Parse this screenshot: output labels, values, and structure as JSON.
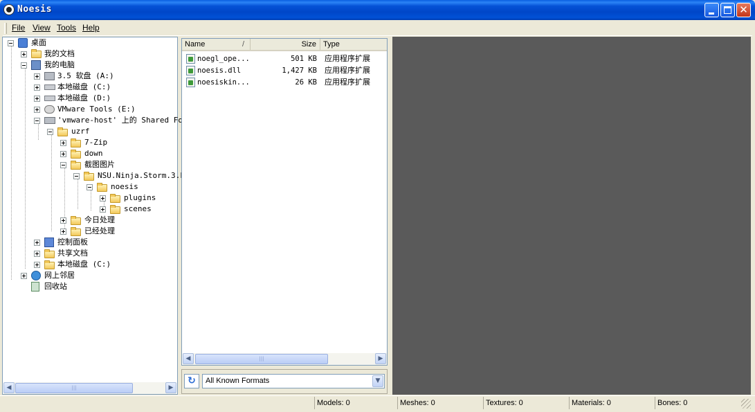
{
  "window": {
    "title": "Noesis"
  },
  "menu": [
    "File",
    "View",
    "Tools",
    "Help"
  ],
  "tree": [
    {
      "label": "桌面"
    },
    {
      "label": "我的文档"
    },
    {
      "label": "我的电脑"
    },
    {
      "label": "3.5 软盘 (A:)"
    },
    {
      "label": "本地磁盘 (C:)"
    },
    {
      "label": "本地磁盘 (D:)"
    },
    {
      "label": "VMware Tools (E:)"
    },
    {
      "label": "'vmware-host' 上的 Shared Fol"
    },
    {
      "label": "uzrf"
    },
    {
      "label": "7-Zip"
    },
    {
      "label": "down"
    },
    {
      "label": "截图图片"
    },
    {
      "label": "NSU.Ninja.Storm.3.F"
    },
    {
      "label": "noesis"
    },
    {
      "label": "plugins"
    },
    {
      "label": "scenes"
    },
    {
      "label": "今日处理"
    },
    {
      "label": "已经处理"
    },
    {
      "label": "控制面板"
    },
    {
      "label": "共享文档"
    },
    {
      "label": "本地磁盘 (C:)"
    },
    {
      "label": "网上邻居"
    },
    {
      "label": "回收站"
    }
  ],
  "file_list": {
    "columns": {
      "name": "Name",
      "sort_indicator": "/",
      "size": "Size",
      "type": "Type"
    },
    "rows": [
      {
        "name": "noegl_ope...",
        "size": "501 KB",
        "type": "应用程序扩展"
      },
      {
        "name": "noesis.dll",
        "size": "1,427 KB",
        "type": "应用程序扩展"
      },
      {
        "name": "noesiskin...",
        "size": "26 KB",
        "type": "应用程序扩展"
      }
    ]
  },
  "format_filter": {
    "selected": "All Known Formats"
  },
  "status": {
    "models": "Models: 0",
    "meshes": "Meshes: 0",
    "textures": "Textures: 0",
    "materials": "Materials: 0",
    "bones": "Bones: 0"
  },
  "colors": {
    "viewport": "#5A5A5A",
    "titlebar": "#0054E3"
  }
}
